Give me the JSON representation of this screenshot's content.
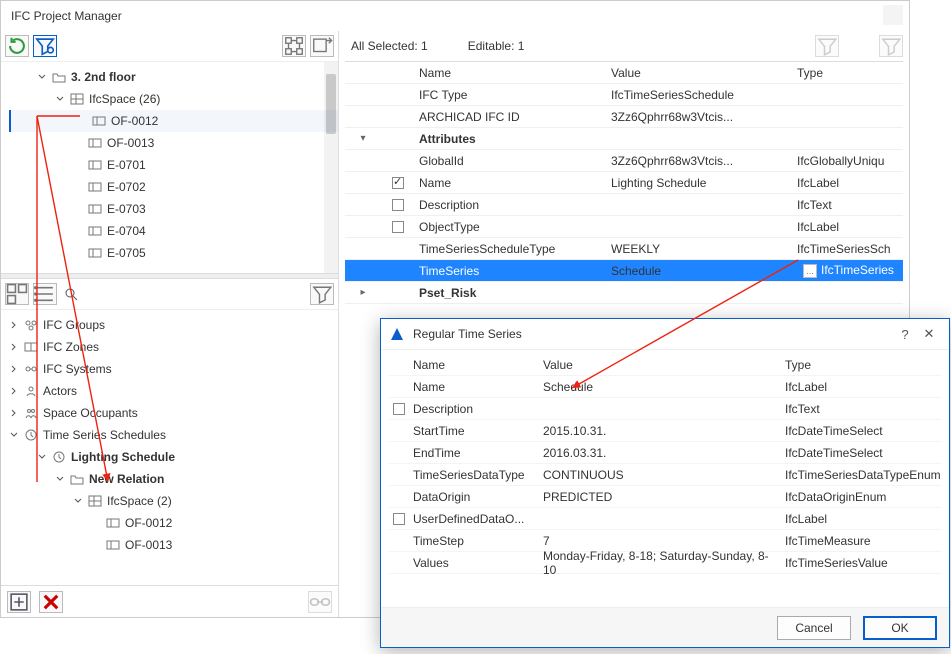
{
  "window": {
    "title": "IFC Project Manager",
    "all_selected": "All Selected: 1",
    "editable": "Editable: 1"
  },
  "tree_top": {
    "floor": "3. 2nd floor",
    "ifc_space": "IfcSpace (26)",
    "items": [
      "OF-0012",
      "OF-0013",
      "E-0701",
      "E-0702",
      "E-0703",
      "E-0704",
      "E-0705"
    ]
  },
  "tree_bottom": {
    "groups": "IFC Groups",
    "zones": "IFC Zones",
    "systems": "IFC Systems",
    "actors": "Actors",
    "occupants": "Space Occupants",
    "tss": "Time Series Schedules",
    "lighting": "Lighting Schedule",
    "new_rel": "New Relation",
    "ifc_space2": "IfcSpace (2)",
    "of1": "OF-0012",
    "of2": "OF-0013"
  },
  "grid": {
    "headers": {
      "name": "Name",
      "value": "Value",
      "type": "Type"
    },
    "rows": [
      {
        "name": "IFC Type",
        "value": "IfcTimeSeriesSchedule",
        "type": "",
        "gray": true
      },
      {
        "name": "ARCHICAD IFC ID",
        "value": "3Zz6Qphrr68w3Vtcis...",
        "type": "",
        "gray": true
      }
    ],
    "attributes_label": "Attributes",
    "attr_rows": [
      {
        "chk": false,
        "name": "GlobalId",
        "value": "3Zz6Qphrr68w3Vtcis...",
        "type": "IfcGloballyUniqu",
        "gray": true
      },
      {
        "chk": true,
        "name": "Name",
        "value": "Lighting Schedule",
        "type": "IfcLabel"
      },
      {
        "chk": false,
        "name": "Description",
        "value": "",
        "type": "IfcText"
      },
      {
        "chk": false,
        "name": "ObjectType",
        "value": "",
        "type": "IfcLabel"
      },
      {
        "chk": null,
        "name": "TimeSeriesScheduleType",
        "value": "WEEKLY",
        "type": "IfcTimeSeriesSch"
      },
      {
        "chk": null,
        "name": "TimeSeries",
        "value": "Schedule",
        "type": "IfcTimeSeries",
        "hl": true,
        "dot": true
      }
    ],
    "pset_label": "Pset_Risk"
  },
  "dialog": {
    "title": "Regular Time Series",
    "headers": {
      "name": "Name",
      "value": "Value",
      "type": "Type"
    },
    "rows": [
      {
        "chk": null,
        "name": "Name",
        "value": "Schedule",
        "type": "IfcLabel"
      },
      {
        "chk": false,
        "name": "Description",
        "value": "",
        "type": "IfcText"
      },
      {
        "chk": null,
        "name": "StartTime",
        "value": "2015.10.31.",
        "type": "IfcDateTimeSelect"
      },
      {
        "chk": null,
        "name": "EndTime",
        "value": "2016.03.31.",
        "type": "IfcDateTimeSelect"
      },
      {
        "chk": null,
        "name": "TimeSeriesDataType",
        "value": "CONTINUOUS",
        "type": "IfcTimeSeriesDataTypeEnum"
      },
      {
        "chk": null,
        "name": "DataOrigin",
        "value": "PREDICTED",
        "type": "IfcDataOriginEnum"
      },
      {
        "chk": false,
        "name": "UserDefinedDataO...",
        "value": "",
        "type": "IfcLabel"
      },
      {
        "chk": null,
        "name": "TimeStep",
        "value": "7",
        "type": "IfcTimeMeasure"
      },
      {
        "chk": null,
        "name": "Values",
        "value": "Monday-Friday, 8-18; Saturday-Sunday, 8-10",
        "type": "IfcTimeSeriesValue"
      }
    ],
    "cancel": "Cancel",
    "ok": "OK"
  }
}
